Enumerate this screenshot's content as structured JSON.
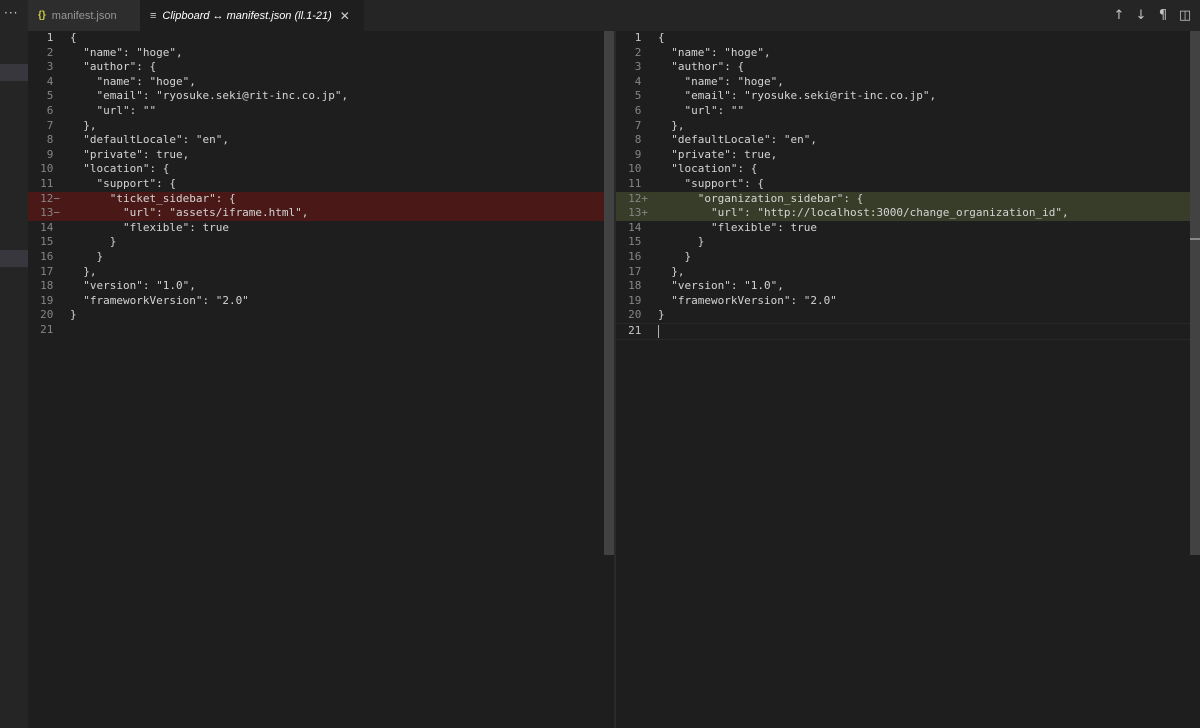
{
  "sidebar": {
    "more_label": "···"
  },
  "tabs": [
    {
      "icon": "{}",
      "label": "manifest.json"
    },
    {
      "icon": "≡",
      "label": "Clipboard ↔ manifest.json (ll.1-21)",
      "close": "✕"
    }
  ],
  "editor_actions": [
    "↑",
    "↓",
    "¶",
    "◫"
  ],
  "left_pane": {
    "lines": [
      {
        "n": "1",
        "text": "{"
      },
      {
        "n": "2",
        "text": "  \"name\": \"hoge\","
      },
      {
        "n": "3",
        "text": "  \"author\": {"
      },
      {
        "n": "4",
        "text": "    \"name\": \"hoge\","
      },
      {
        "n": "5",
        "text": "    \"email\": \"ryosuke.seki@rit-inc.co.jp\","
      },
      {
        "n": "6",
        "text": "    \"url\": \"\""
      },
      {
        "n": "7",
        "text": "  },"
      },
      {
        "n": "8",
        "text": "  \"defaultLocale\": \"en\","
      },
      {
        "n": "9",
        "text": "  \"private\": true,"
      },
      {
        "n": "10",
        "text": "  \"location\": {"
      },
      {
        "n": "11",
        "text": "    \"support\": {"
      },
      {
        "n": "12",
        "mark": "−",
        "text": "      \"ticket_sidebar\": {",
        "type": "del"
      },
      {
        "n": "13",
        "mark": "−",
        "text": "        \"url\": \"assets/iframe.html\",",
        "type": "del"
      },
      {
        "n": "14",
        "text": "        \"flexible\": true"
      },
      {
        "n": "15",
        "text": "      }"
      },
      {
        "n": "16",
        "text": "    }"
      },
      {
        "n": "17",
        "text": "  },"
      },
      {
        "n": "18",
        "text": "  \"version\": \"1.0\","
      },
      {
        "n": "19",
        "text": "  \"frameworkVersion\": \"2.0\""
      },
      {
        "n": "20",
        "text": "}"
      },
      {
        "n": "21",
        "text": ""
      }
    ]
  },
  "right_pane": {
    "lines": [
      {
        "n": "1",
        "text": "{"
      },
      {
        "n": "2",
        "text": "  \"name\": \"hoge\","
      },
      {
        "n": "3",
        "text": "  \"author\": {"
      },
      {
        "n": "4",
        "text": "    \"name\": \"hoge\","
      },
      {
        "n": "5",
        "text": "    \"email\": \"ryosuke.seki@rit-inc.co.jp\","
      },
      {
        "n": "6",
        "text": "    \"url\": \"\""
      },
      {
        "n": "7",
        "text": "  },"
      },
      {
        "n": "8",
        "text": "  \"defaultLocale\": \"en\","
      },
      {
        "n": "9",
        "text": "  \"private\": true,"
      },
      {
        "n": "10",
        "text": "  \"location\": {"
      },
      {
        "n": "11",
        "text": "    \"support\": {"
      },
      {
        "n": "12",
        "mark": "+",
        "text": "      \"organization_sidebar\": {",
        "type": "ins"
      },
      {
        "n": "13",
        "mark": "+",
        "text": "        \"url\": \"http://localhost:3000/change_organization_id\",",
        "type": "ins"
      },
      {
        "n": "14",
        "text": "        \"flexible\": true"
      },
      {
        "n": "15",
        "text": "      }"
      },
      {
        "n": "16",
        "text": "    }"
      },
      {
        "n": "17",
        "text": "  },"
      },
      {
        "n": "18",
        "text": "  \"version\": \"1.0\","
      },
      {
        "n": "19",
        "text": "  \"frameworkVersion\": \"2.0\""
      },
      {
        "n": "20",
        "text": "}"
      },
      {
        "n": "21",
        "text": "",
        "cursor": true
      }
    ]
  }
}
